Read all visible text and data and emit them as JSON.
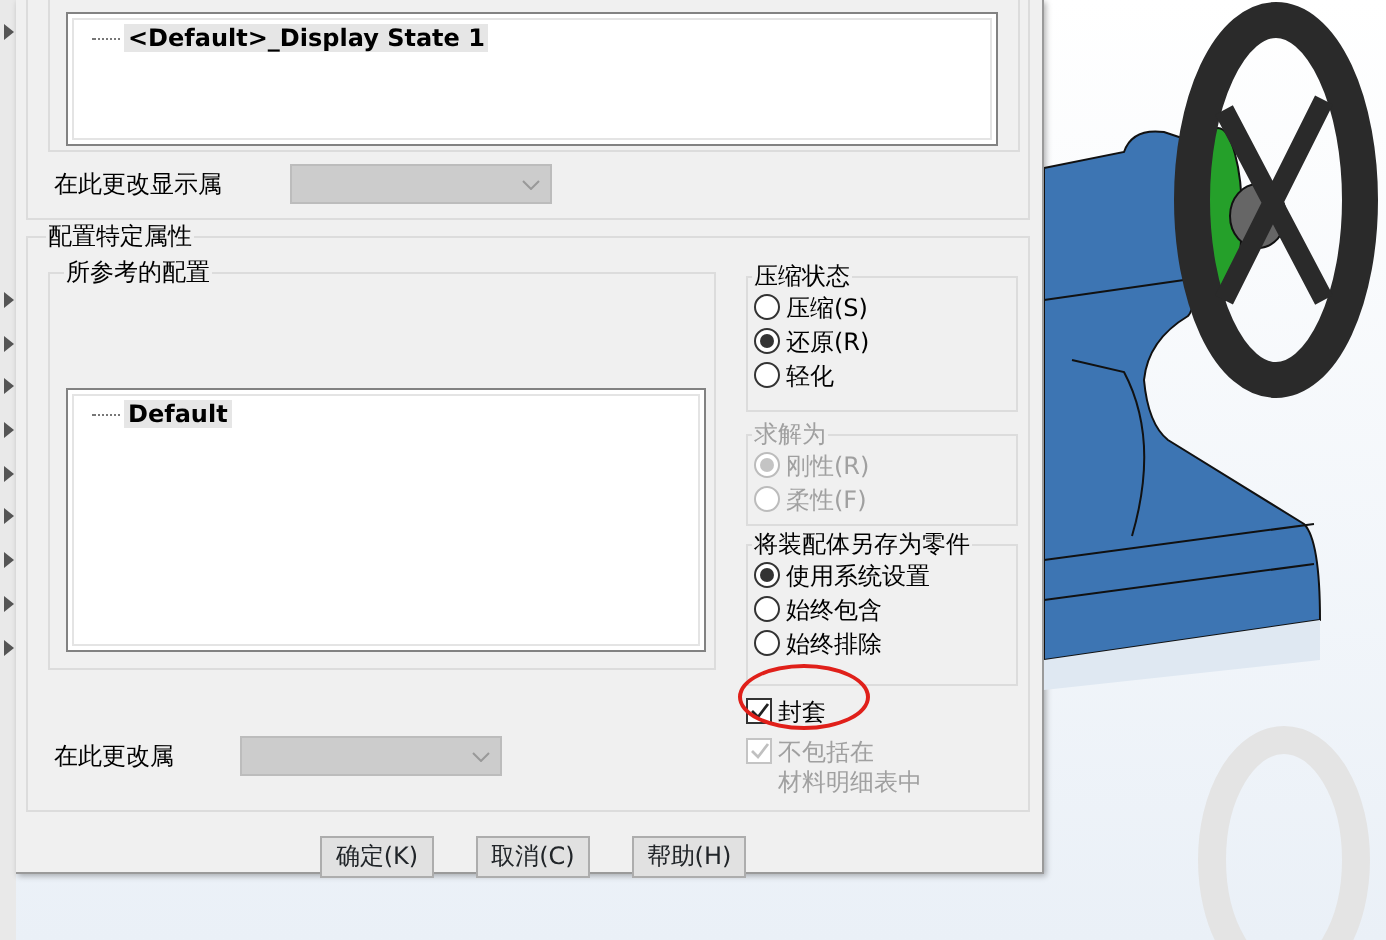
{
  "display_states": {
    "items": [
      {
        "label": "<Default>_Display State 1",
        "selected": true
      }
    ]
  },
  "display_change": {
    "label": "在此更改显示属",
    "dropdown": {
      "disabled": true
    }
  },
  "config_group": {
    "title": "配置特定属性",
    "referenced": {
      "title": "所参考的配置",
      "items": [
        {
          "label": "Default",
          "selected": true
        }
      ]
    },
    "option_groups": [
      {
        "title": "压缩状态",
        "disabled": false,
        "options": [
          {
            "label": "压缩(S)",
            "selected": false
          },
          {
            "label": "还原(R)",
            "selected": true
          },
          {
            "label": "轻化",
            "selected": false
          }
        ]
      },
      {
        "title": "求解为",
        "disabled": true,
        "options": [
          {
            "label": "刚性(R)",
            "selected": true
          },
          {
            "label": "柔性(F)",
            "selected": false
          }
        ]
      },
      {
        "title": "将装配体另存为零件",
        "disabled": false,
        "options": [
          {
            "label": "使用系统设置",
            "selected": true
          },
          {
            "label": "始终包含",
            "selected": false
          },
          {
            "label": "始终排除",
            "selected": false
          }
        ]
      }
    ],
    "envelope": {
      "label": "封套",
      "checked": true,
      "disabled": false,
      "highlighted": true
    },
    "exclude_bom": {
      "label_lines": [
        "不包括在",
        "材料明细表中"
      ],
      "checked": true,
      "disabled": true
    },
    "change_here": {
      "label": "在此更改属",
      "dropdown": {
        "disabled": true
      }
    }
  },
  "buttons": [
    {
      "label": "确定(K)"
    },
    {
      "label": "取消(C)"
    },
    {
      "label": "帮助(H)"
    }
  ]
}
